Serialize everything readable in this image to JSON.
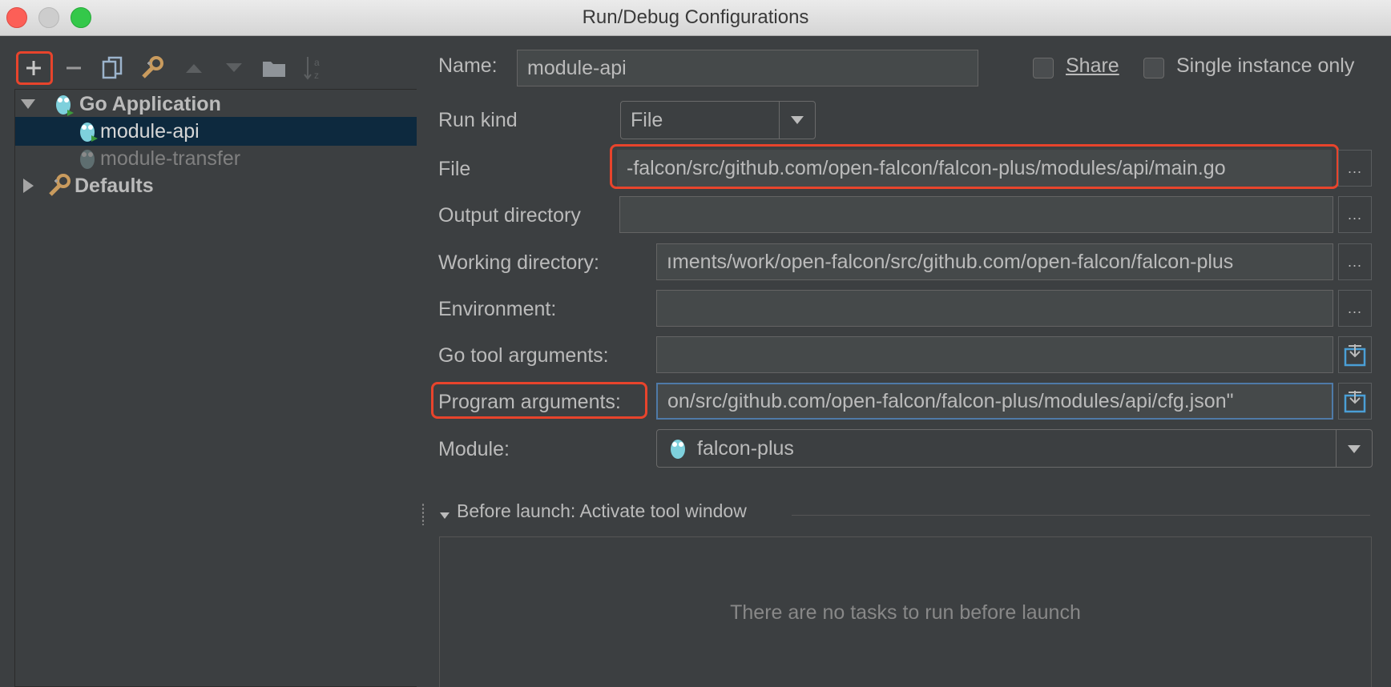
{
  "window": {
    "title": "Run/Debug Configurations"
  },
  "toolbar": {
    "add": "plus-icon",
    "remove": "minus-icon",
    "copy": "copy-icon",
    "edit_defaults": "wrench-icon",
    "move_up": "arrow-up-icon",
    "move_down": "arrow-down-icon",
    "folder": "folder-icon",
    "sort": "sort-az-icon"
  },
  "tree": {
    "groups": [
      {
        "label": "Go Application",
        "expanded": true,
        "icon": "gopher-icon",
        "children": [
          {
            "label": "module-api",
            "selected": true,
            "icon": "gopher-run-icon"
          },
          {
            "label": "module-transfer",
            "selected": false,
            "icon": "gopher-disabled-icon"
          }
        ]
      },
      {
        "label": "Defaults",
        "expanded": false,
        "icon": "wrench-icon"
      }
    ]
  },
  "form": {
    "name_label": "Name:",
    "name_value": "module-api",
    "share_label": "Share",
    "single_instance_label": "Single instance only",
    "run_kind_label": "Run kind",
    "run_kind_value": "File",
    "file_label": "File",
    "file_value": "-falcon/src/github.com/open-falcon/falcon-plus/modules/api/main.go",
    "output_dir_label": "Output directory",
    "output_dir_value": "",
    "working_dir_label": "Working directory:",
    "working_dir_value": "ıments/work/open-falcon/src/github.com/open-falcon/falcon-plus",
    "environment_label": "Environment:",
    "environment_value": "",
    "go_tool_args_label": "Go tool arguments:",
    "go_tool_args_value": "",
    "program_args_label": "Program arguments:",
    "program_args_value": "on/src/github.com/open-falcon/falcon-plus/modules/api/cfg.json\"",
    "module_label": "Module:",
    "module_value": "falcon-plus",
    "browse_label": "..."
  },
  "before_launch": {
    "title": "Before launch: Activate tool window",
    "empty_text": "There are no tasks to run before launch"
  },
  "colors": {
    "highlight": "#e8442c",
    "selection": "#0d293e",
    "background": "#3c3f41"
  }
}
